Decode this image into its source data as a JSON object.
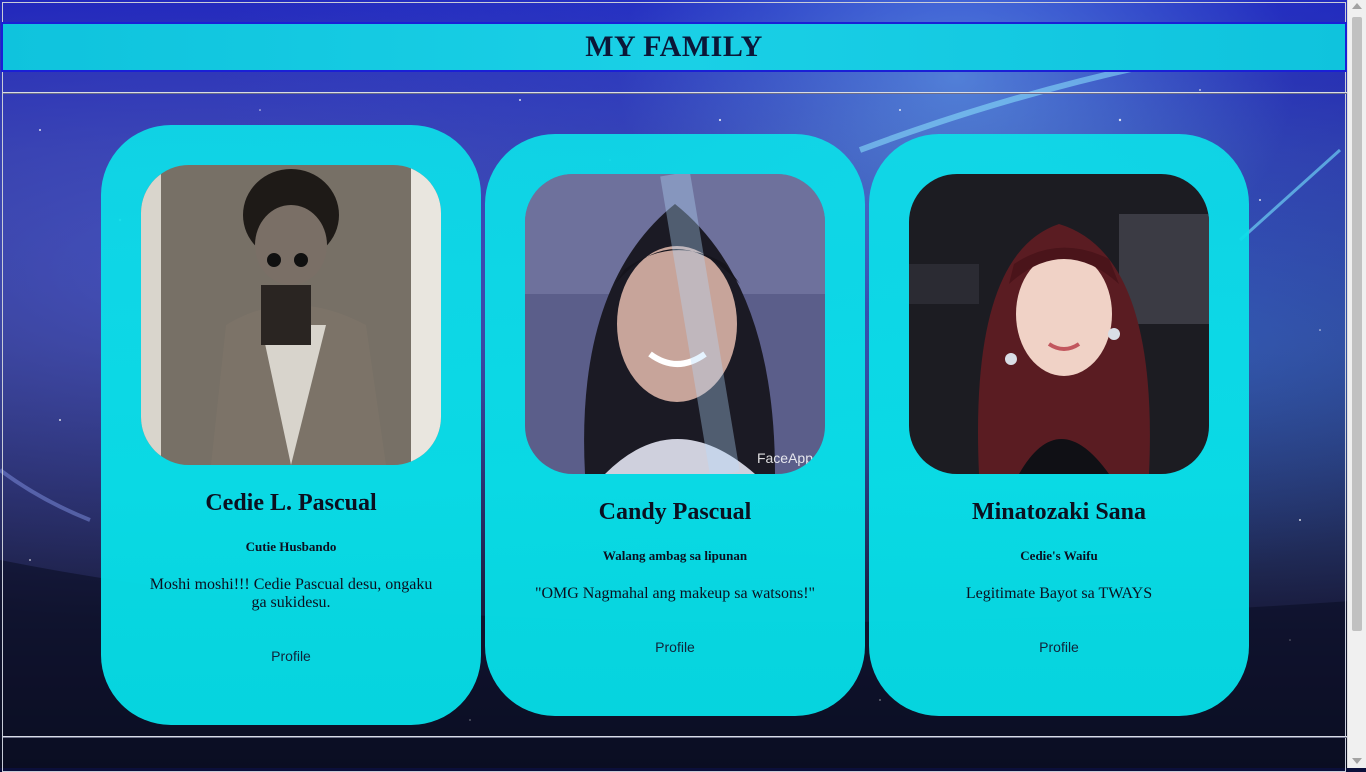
{
  "header": {
    "title": "MY FAMILY"
  },
  "cards": [
    {
      "name": "Cedie L. Pascual",
      "role": "Cutie Husbando",
      "description": "Moshi moshi!!! Cedie Pascual desu, ongaku ga sukidesu.",
      "link": "Profile"
    },
    {
      "name": "Candy Pascual",
      "role": "Walang ambag sa lipunan",
      "description": "\"OMG Nagmahal ang makeup sa watsons!\"",
      "link": "Profile",
      "photo_watermark": "FaceApp"
    },
    {
      "name": "Minatozaki Sana",
      "role": "Cedie's Waifu",
      "description": "Legitimate Bayot sa TWAYS",
      "link": "Profile"
    }
  ],
  "colors": {
    "card": "#0de0e8",
    "header": "#14cce2",
    "header_border": "#1a1fd6",
    "title": "#0b1738"
  }
}
